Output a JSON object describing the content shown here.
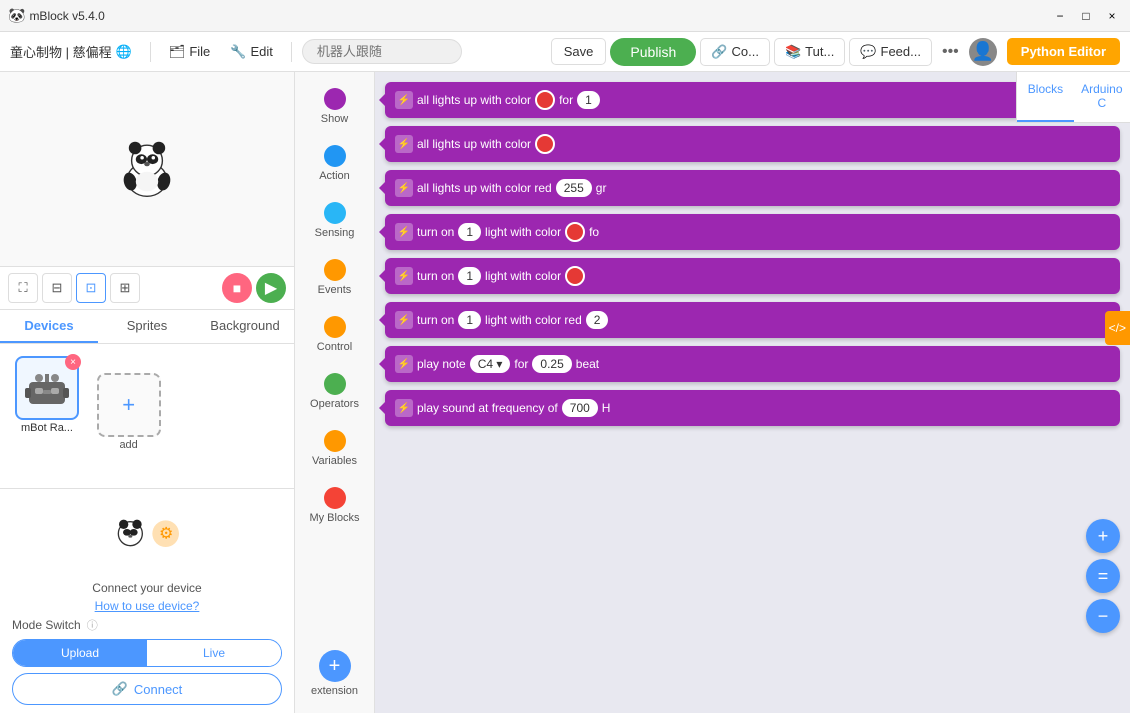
{
  "app": {
    "title": "mBlock v5.4.0",
    "icon": "🐼"
  },
  "titlebar": {
    "title": "mBlock v5.4.0",
    "minimize": "−",
    "maximize": "□",
    "close": "×"
  },
  "menubar": {
    "brand": "童心制物 | 慈偏程",
    "globe_icon": "🌐",
    "file_label": "File",
    "edit_label": "Edit",
    "search_placeholder": "机器人跟随",
    "save_label": "Save",
    "publish_label": "Publish",
    "connect_label": "Co...",
    "tutorial_label": "Tut...",
    "feedback_label": "Feed...",
    "more_label": "•••",
    "python_editor_label": "Python Editor"
  },
  "left_panel": {
    "tabs": [
      "Devices",
      "Sprites",
      "Background"
    ],
    "active_tab": "Devices",
    "device": {
      "name": "mBot Ra...",
      "close_label": "×"
    },
    "add_label": "add",
    "connect_prompt": "Connect your device",
    "how_to_link": "How to use device?",
    "mode_switch_label": "Mode Switch",
    "mode_info": "ⓘ",
    "upload_label": "Upload",
    "live_label": "Live",
    "connect_label": "Connect"
  },
  "categories": [
    {
      "id": "show",
      "label": "Show",
      "color": "#9c27b0"
    },
    {
      "id": "action",
      "label": "Action",
      "color": "#2196f3"
    },
    {
      "id": "sensing",
      "label": "Sensing",
      "color": "#2196f3"
    },
    {
      "id": "events",
      "label": "Events",
      "color": "#ff9800"
    },
    {
      "id": "control",
      "label": "Control",
      "color": "#ff9800"
    },
    {
      "id": "operators",
      "label": "Operators",
      "color": "#4caf50"
    },
    {
      "id": "variables",
      "label": "Variables",
      "color": "#ff9800"
    },
    {
      "id": "my_blocks",
      "label": "My Blocks",
      "color": "#f44336"
    }
  ],
  "extension_label": "extension",
  "blocks": [
    {
      "id": "b1",
      "text": "all lights up with color",
      "has_color_circle": true,
      "color_value": "#e53935",
      "suffix": "for",
      "has_number": true,
      "number_value": "1"
    },
    {
      "id": "b2",
      "text": "all lights up with color",
      "has_color_circle": true,
      "color_value": "#e53935",
      "suffix": "",
      "has_number": false,
      "number_value": ""
    },
    {
      "id": "b3",
      "text": "all lights up with color red",
      "has_color_circle": false,
      "suffix": "",
      "has_number": true,
      "number_value": "255",
      "extra_text": "gr"
    },
    {
      "id": "b4",
      "text": "turn on",
      "has_index": true,
      "index_value": "1",
      "suffix": "light with color",
      "has_color_circle": true,
      "color_value": "#e53935",
      "extra_text": "fo"
    },
    {
      "id": "b5",
      "text": "turn on",
      "has_index": true,
      "index_value": "1",
      "suffix": "light with color",
      "has_color_circle": true,
      "color_value": "#e53935",
      "extra_text": ""
    },
    {
      "id": "b6",
      "text": "turn on",
      "has_index": true,
      "index_value": "1",
      "suffix": "light with color red",
      "has_number": true,
      "number_value": "2",
      "extra_text": ""
    },
    {
      "id": "b7",
      "text": "play note",
      "has_dropdown": true,
      "dropdown_value": "C4",
      "suffix": "for",
      "has_oval": true,
      "oval_value": "0.25",
      "end_text": "beat"
    },
    {
      "id": "b8",
      "text": "play sound at frequency of",
      "has_oval": true,
      "oval_value": "700",
      "end_text": "H"
    }
  ],
  "workspace": {
    "zoom_in": "+",
    "zoom_out": "−",
    "zoom_reset": "="
  },
  "right_panel": {
    "tabs": [
      "Blocks",
      "Arduino C"
    ],
    "active_tab": "Blocks",
    "code_toggle": "</>"
  }
}
